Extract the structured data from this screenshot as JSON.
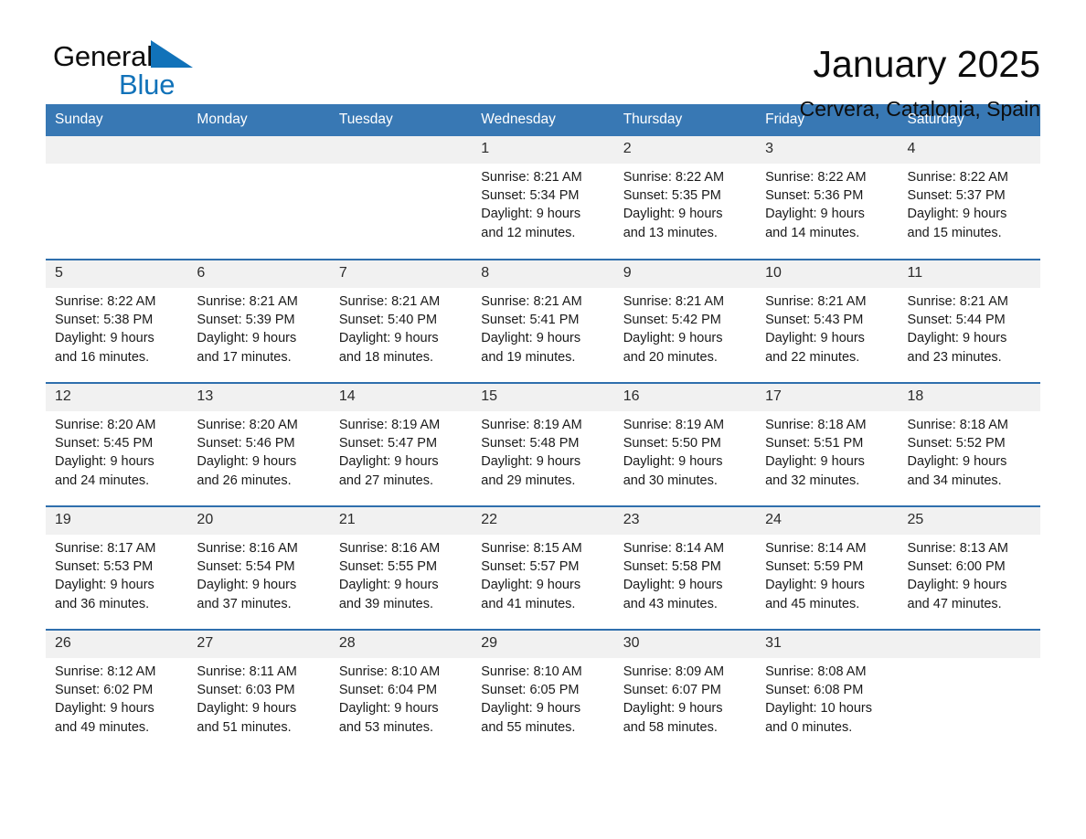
{
  "brand": {
    "name_part1": "General",
    "name_part2": "Blue",
    "triangle_color": "#1172b9"
  },
  "header": {
    "title": "January 2025",
    "subtitle": "Cervera, Catalonia, Spain"
  },
  "colors": {
    "header_blue": "#3878b4",
    "row_divider_blue": "#2f6fad",
    "daynum_bg": "#f1f1f1"
  },
  "weekday_headers": [
    "Sunday",
    "Monday",
    "Tuesday",
    "Wednesday",
    "Thursday",
    "Friday",
    "Saturday"
  ],
  "weeks": [
    [
      {
        "day": "",
        "sunrise": "",
        "sunset": "",
        "daylight_1": "",
        "daylight_2": ""
      },
      {
        "day": "",
        "sunrise": "",
        "sunset": "",
        "daylight_1": "",
        "daylight_2": ""
      },
      {
        "day": "",
        "sunrise": "",
        "sunset": "",
        "daylight_1": "",
        "daylight_2": ""
      },
      {
        "day": "1",
        "sunrise": "Sunrise: 8:21 AM",
        "sunset": "Sunset: 5:34 PM",
        "daylight_1": "Daylight: 9 hours",
        "daylight_2": "and 12 minutes."
      },
      {
        "day": "2",
        "sunrise": "Sunrise: 8:22 AM",
        "sunset": "Sunset: 5:35 PM",
        "daylight_1": "Daylight: 9 hours",
        "daylight_2": "and 13 minutes."
      },
      {
        "day": "3",
        "sunrise": "Sunrise: 8:22 AM",
        "sunset": "Sunset: 5:36 PM",
        "daylight_1": "Daylight: 9 hours",
        "daylight_2": "and 14 minutes."
      },
      {
        "day": "4",
        "sunrise": "Sunrise: 8:22 AM",
        "sunset": "Sunset: 5:37 PM",
        "daylight_1": "Daylight: 9 hours",
        "daylight_2": "and 15 minutes."
      }
    ],
    [
      {
        "day": "5",
        "sunrise": "Sunrise: 8:22 AM",
        "sunset": "Sunset: 5:38 PM",
        "daylight_1": "Daylight: 9 hours",
        "daylight_2": "and 16 minutes."
      },
      {
        "day": "6",
        "sunrise": "Sunrise: 8:21 AM",
        "sunset": "Sunset: 5:39 PM",
        "daylight_1": "Daylight: 9 hours",
        "daylight_2": "and 17 minutes."
      },
      {
        "day": "7",
        "sunrise": "Sunrise: 8:21 AM",
        "sunset": "Sunset: 5:40 PM",
        "daylight_1": "Daylight: 9 hours",
        "daylight_2": "and 18 minutes."
      },
      {
        "day": "8",
        "sunrise": "Sunrise: 8:21 AM",
        "sunset": "Sunset: 5:41 PM",
        "daylight_1": "Daylight: 9 hours",
        "daylight_2": "and 19 minutes."
      },
      {
        "day": "9",
        "sunrise": "Sunrise: 8:21 AM",
        "sunset": "Sunset: 5:42 PM",
        "daylight_1": "Daylight: 9 hours",
        "daylight_2": "and 20 minutes."
      },
      {
        "day": "10",
        "sunrise": "Sunrise: 8:21 AM",
        "sunset": "Sunset: 5:43 PM",
        "daylight_1": "Daylight: 9 hours",
        "daylight_2": "and 22 minutes."
      },
      {
        "day": "11",
        "sunrise": "Sunrise: 8:21 AM",
        "sunset": "Sunset: 5:44 PM",
        "daylight_1": "Daylight: 9 hours",
        "daylight_2": "and 23 minutes."
      }
    ],
    [
      {
        "day": "12",
        "sunrise": "Sunrise: 8:20 AM",
        "sunset": "Sunset: 5:45 PM",
        "daylight_1": "Daylight: 9 hours",
        "daylight_2": "and 24 minutes."
      },
      {
        "day": "13",
        "sunrise": "Sunrise: 8:20 AM",
        "sunset": "Sunset: 5:46 PM",
        "daylight_1": "Daylight: 9 hours",
        "daylight_2": "and 26 minutes."
      },
      {
        "day": "14",
        "sunrise": "Sunrise: 8:19 AM",
        "sunset": "Sunset: 5:47 PM",
        "daylight_1": "Daylight: 9 hours",
        "daylight_2": "and 27 minutes."
      },
      {
        "day": "15",
        "sunrise": "Sunrise: 8:19 AM",
        "sunset": "Sunset: 5:48 PM",
        "daylight_1": "Daylight: 9 hours",
        "daylight_2": "and 29 minutes."
      },
      {
        "day": "16",
        "sunrise": "Sunrise: 8:19 AM",
        "sunset": "Sunset: 5:50 PM",
        "daylight_1": "Daylight: 9 hours",
        "daylight_2": "and 30 minutes."
      },
      {
        "day": "17",
        "sunrise": "Sunrise: 8:18 AM",
        "sunset": "Sunset: 5:51 PM",
        "daylight_1": "Daylight: 9 hours",
        "daylight_2": "and 32 minutes."
      },
      {
        "day": "18",
        "sunrise": "Sunrise: 8:18 AM",
        "sunset": "Sunset: 5:52 PM",
        "daylight_1": "Daylight: 9 hours",
        "daylight_2": "and 34 minutes."
      }
    ],
    [
      {
        "day": "19",
        "sunrise": "Sunrise: 8:17 AM",
        "sunset": "Sunset: 5:53 PM",
        "daylight_1": "Daylight: 9 hours",
        "daylight_2": "and 36 minutes."
      },
      {
        "day": "20",
        "sunrise": "Sunrise: 8:16 AM",
        "sunset": "Sunset: 5:54 PM",
        "daylight_1": "Daylight: 9 hours",
        "daylight_2": "and 37 minutes."
      },
      {
        "day": "21",
        "sunrise": "Sunrise: 8:16 AM",
        "sunset": "Sunset: 5:55 PM",
        "daylight_1": "Daylight: 9 hours",
        "daylight_2": "and 39 minutes."
      },
      {
        "day": "22",
        "sunrise": "Sunrise: 8:15 AM",
        "sunset": "Sunset: 5:57 PM",
        "daylight_1": "Daylight: 9 hours",
        "daylight_2": "and 41 minutes."
      },
      {
        "day": "23",
        "sunrise": "Sunrise: 8:14 AM",
        "sunset": "Sunset: 5:58 PM",
        "daylight_1": "Daylight: 9 hours",
        "daylight_2": "and 43 minutes."
      },
      {
        "day": "24",
        "sunrise": "Sunrise: 8:14 AM",
        "sunset": "Sunset: 5:59 PM",
        "daylight_1": "Daylight: 9 hours",
        "daylight_2": "and 45 minutes."
      },
      {
        "day": "25",
        "sunrise": "Sunrise: 8:13 AM",
        "sunset": "Sunset: 6:00 PM",
        "daylight_1": "Daylight: 9 hours",
        "daylight_2": "and 47 minutes."
      }
    ],
    [
      {
        "day": "26",
        "sunrise": "Sunrise: 8:12 AM",
        "sunset": "Sunset: 6:02 PM",
        "daylight_1": "Daylight: 9 hours",
        "daylight_2": "and 49 minutes."
      },
      {
        "day": "27",
        "sunrise": "Sunrise: 8:11 AM",
        "sunset": "Sunset: 6:03 PM",
        "daylight_1": "Daylight: 9 hours",
        "daylight_2": "and 51 minutes."
      },
      {
        "day": "28",
        "sunrise": "Sunrise: 8:10 AM",
        "sunset": "Sunset: 6:04 PM",
        "daylight_1": "Daylight: 9 hours",
        "daylight_2": "and 53 minutes."
      },
      {
        "day": "29",
        "sunrise": "Sunrise: 8:10 AM",
        "sunset": "Sunset: 6:05 PM",
        "daylight_1": "Daylight: 9 hours",
        "daylight_2": "and 55 minutes."
      },
      {
        "day": "30",
        "sunrise": "Sunrise: 8:09 AM",
        "sunset": "Sunset: 6:07 PM",
        "daylight_1": "Daylight: 9 hours",
        "daylight_2": "and 58 minutes."
      },
      {
        "day": "31",
        "sunrise": "Sunrise: 8:08 AM",
        "sunset": "Sunset: 6:08 PM",
        "daylight_1": "Daylight: 10 hours",
        "daylight_2": "and 0 minutes."
      },
      {
        "day": "",
        "sunrise": "",
        "sunset": "",
        "daylight_1": "",
        "daylight_2": ""
      }
    ]
  ]
}
